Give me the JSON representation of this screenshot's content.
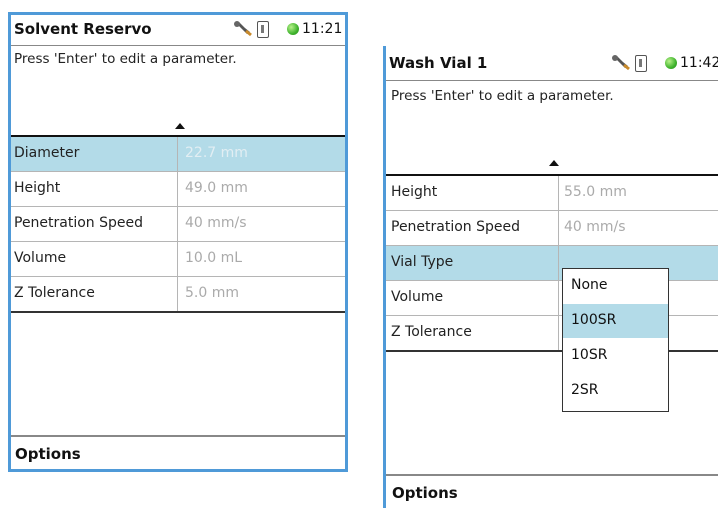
{
  "screen1": {
    "title": "Solvent Reservo",
    "clock": "11:21",
    "prompt": "Press 'Enter' to edit a parameter.",
    "params": [
      {
        "label": "Diameter",
        "value": "22.7 mm"
      },
      {
        "label": "Height",
        "value": "49.0 mm"
      },
      {
        "label": "Penetration Speed",
        "value": "40 mm/s"
      },
      {
        "label": "Volume",
        "value": "10.0 mL"
      },
      {
        "label": "Z Tolerance",
        "value": "5.0 mm"
      }
    ],
    "selected_index": 0,
    "options_label": "Options"
  },
  "screen2": {
    "title": "Wash Vial 1",
    "clock": "11:42",
    "prompt": "Press 'Enter' to edit a parameter.",
    "params": [
      {
        "label": "Height",
        "value": "55.0 mm"
      },
      {
        "label": "Penetration Speed",
        "value": "40 mm/s"
      },
      {
        "label": "Vial Type",
        "value": ""
      },
      {
        "label": "Volume",
        "value": ""
      },
      {
        "label": "Z Tolerance",
        "value": ""
      }
    ],
    "selected_index": 2,
    "dropdown": {
      "options": [
        "None",
        "100SR",
        "10SR",
        "2SR"
      ],
      "selected": "100SR"
    },
    "options_label": "Options"
  },
  "colors": {
    "frame_border": "#4f9ad8",
    "selection": "#b3dbe8",
    "status_led": "#3fb32d"
  },
  "icons": [
    "wrench-icon",
    "usb-icon",
    "status-led-icon"
  ]
}
